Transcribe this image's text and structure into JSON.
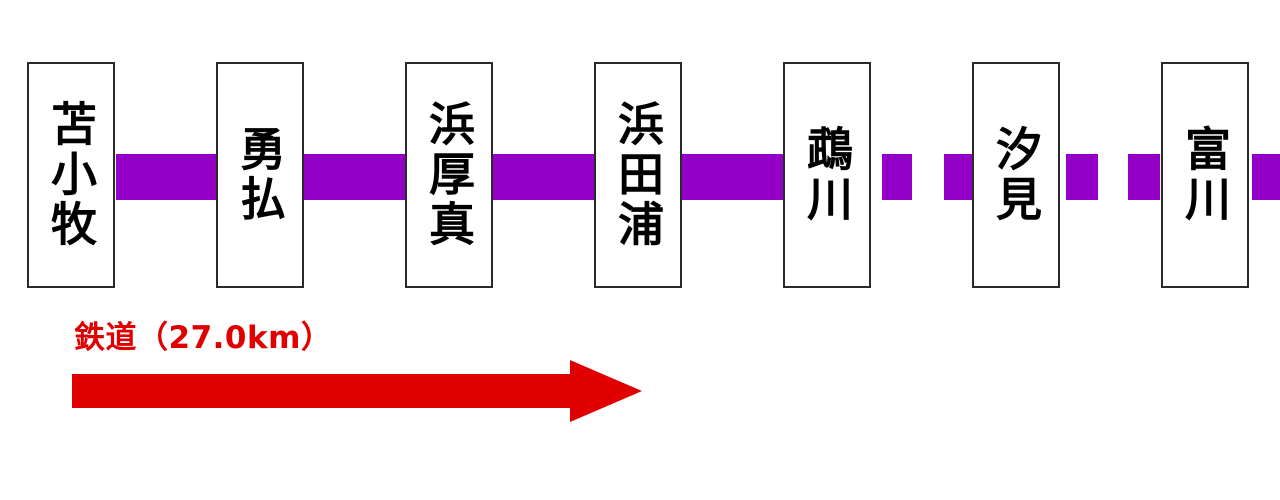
{
  "stations": [
    {
      "name": "苫小牧"
    },
    {
      "name": "勇払"
    },
    {
      "name": "浜厚真"
    },
    {
      "name": "浜田浦"
    },
    {
      "name": "鵡川"
    },
    {
      "name": "汐見"
    },
    {
      "name": "富川"
    }
  ],
  "railway": {
    "label": "鉄道（27.0km）",
    "line_color": "#9400c8",
    "arrow_color": "#e00000"
  }
}
